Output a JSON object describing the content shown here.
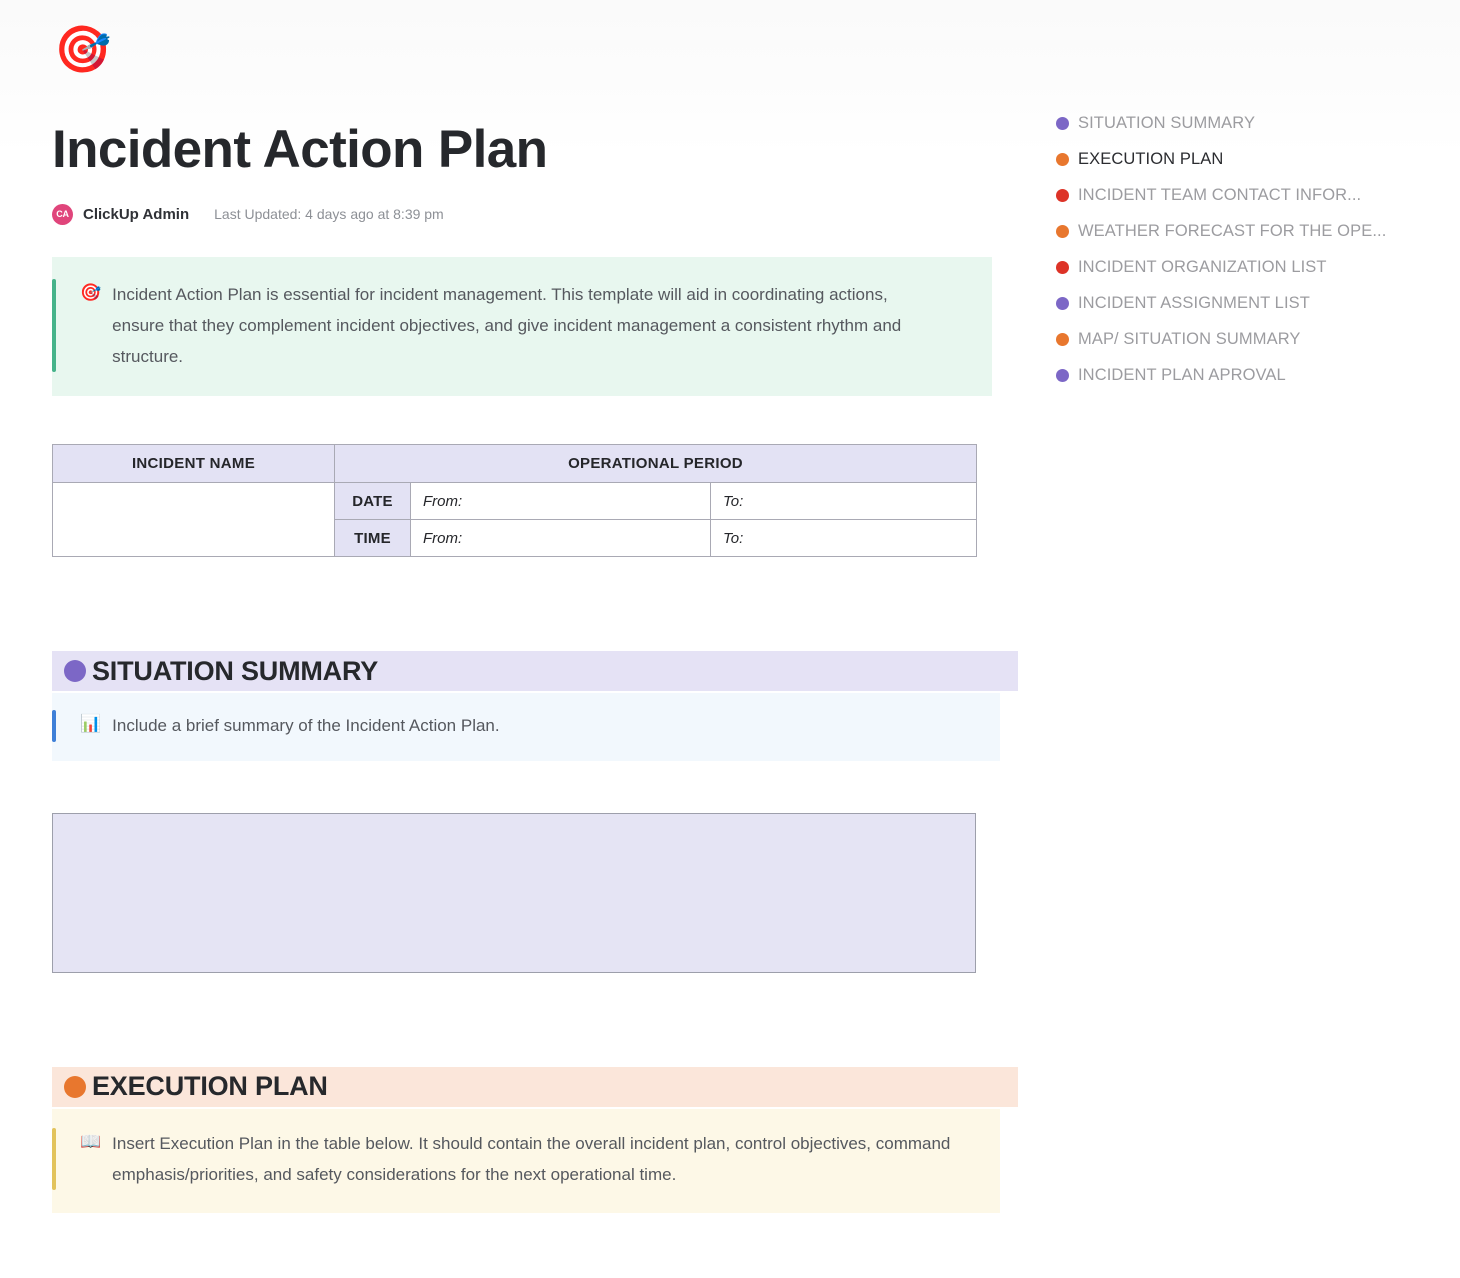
{
  "document": {
    "header_emoji": "🎯",
    "header_emoji_name": "dart-target-emoji",
    "title": "Incident Action Plan",
    "author": "ClickUp Admin",
    "author_initials": "CA",
    "last_updated": "Last Updated: 4 days ago at 8:39 pm"
  },
  "intro_callout": {
    "emoji": "🎯",
    "text": "Incident Action Plan is essential for incident management. This template will aid in coordinating actions, ensure that they complement incident objectives, and give incident management a consistent rhythm and structure.",
    "accent_color": "#46b38a",
    "background_color": "#e8f7ef"
  },
  "incident_table": {
    "headers": [
      "INCIDENT NAME",
      "OPERATIONAL PERIOD"
    ],
    "rows": [
      {
        "label": "DATE",
        "from": "From:",
        "to": "To:"
      },
      {
        "label": "TIME",
        "from": "From:",
        "to": "To:"
      }
    ],
    "incident_name_value": "",
    "header_background": "#e3e2f4"
  },
  "sections": [
    {
      "title": "SITUATION SUMMARY",
      "dot_color": "#7c67c6",
      "band_color": "#e5e2f5",
      "callout": {
        "emoji": "📊",
        "emoji_name": "bar-chart-emoji",
        "text": "Include a brief summary of the Incident Action Plan.",
        "accent_color": "#3f80d8",
        "background_color": "#f2f8fd"
      }
    },
    {
      "title": "EXECUTION PLAN",
      "dot_color": "#e8772e",
      "band_color": "#fbe6da",
      "callout": {
        "emoji": "📖",
        "emoji_name": "open-book-emoji",
        "text": "Insert Execution Plan in the table below. It should contain the overall incident plan, control objectives, command emphasis/priorities, and safety considerations for the next operational time.",
        "accent_color": "#e2c35c",
        "background_color": "#fdf8e7"
      }
    }
  ],
  "entry_box": {
    "value": "",
    "background_color": "#e5e4f4",
    "border_color": "#9d9fab"
  },
  "outline": {
    "items": [
      {
        "label": "SITUATION SUMMARY",
        "color": "#7c67c6",
        "active": false
      },
      {
        "label": "EXECUTION PLAN",
        "color": "#e8772e",
        "active": true
      },
      {
        "label": "INCIDENT TEAM CONTACT INFOR...",
        "color": "#dd3327",
        "active": false
      },
      {
        "label": "WEATHER FORECAST FOR THE OPE...",
        "color": "#e8772e",
        "active": false
      },
      {
        "label": "INCIDENT ORGANIZATION LIST",
        "color": "#dd3327",
        "active": false
      },
      {
        "label": "INCIDENT ASSIGNMENT LIST",
        "color": "#7c67c6",
        "active": false
      },
      {
        "label": "MAP/ SITUATION SUMMARY",
        "color": "#e8772e",
        "active": false
      },
      {
        "label": "INCIDENT PLAN APROVAL",
        "color": "#7c67c6",
        "active": false
      }
    ]
  }
}
